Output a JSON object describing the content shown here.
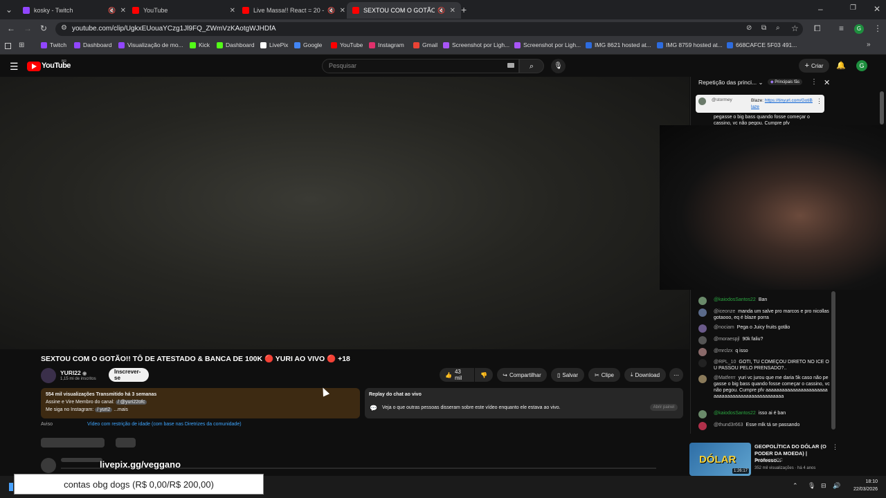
{
  "tabs": [
    {
      "title": "kosky - Twitch",
      "color": "#9146ff",
      "muted": true
    },
    {
      "title": "YouTube",
      "color": "#ff0000",
      "muted": false
    },
    {
      "title": "Live Massa!! React = 20 - Yo",
      "color": "#ff0000",
      "muted": true
    },
    {
      "title": "SEXTOU COM O GOTÃO!! TÔ",
      "color": "#ff0000",
      "muted": true
    }
  ],
  "address": {
    "url": "youtube.com/clip/UgkxEUouaYCzg1Jl9FQ_ZWmVzKAotgWJHDfA"
  },
  "bookmarks": [
    {
      "label": "Twitch",
      "color": "#9146ff"
    },
    {
      "label": "Dashboard",
      "color": "#9146ff"
    },
    {
      "label": "Visualização de mo...",
      "color": "#9146ff"
    },
    {
      "label": "Kick",
      "color": "#53fc18"
    },
    {
      "label": "Dashboard",
      "color": "#53fc18"
    },
    {
      "label": "LivePix",
      "color": "#ffffff"
    },
    {
      "label": "Google",
      "color": "#4285f4"
    },
    {
      "label": "YouTube",
      "color": "#ff0000"
    },
    {
      "label": "Instagram",
      "color": "#e1306c"
    },
    {
      "label": "Gmail",
      "color": "#ea4335"
    },
    {
      "label": "Screenshot por Ligh...",
      "color": "#a855f7"
    },
    {
      "label": "Screenshot por Ligh...",
      "color": "#a855f7"
    },
    {
      "label": "IMG 8621 hosted at...",
      "color": "#2d6cdf"
    },
    {
      "label": "IMG 8759 hosted at...",
      "color": "#2d6cdf"
    },
    {
      "label": "668CAFCE 5F03 491...",
      "color": "#2d6cdf"
    }
  ],
  "yt": {
    "logo": "YouTube",
    "region": "BR",
    "search_placeholder": "Pesquisar",
    "create_label": "Criar",
    "avatar_letter": "G"
  },
  "video": {
    "title": "SEXTOU COM O GOTÃO!! TÔ DE ATESTADO & BANCA DE 100K 🔴 YURI AO VIVO 🔴 +18",
    "channel": "YURI22",
    "subscribers": "1,15 mi de inscritos",
    "subscribe_label": "Inscrever-se",
    "likes": "43 mil",
    "share_label": "Compartilhar",
    "save_label": "Salvar",
    "clip_label": "Clipe",
    "download_label": "Download"
  },
  "description": {
    "stats": "554 mil visualizações  Transmitido há 3 semanas",
    "line1": "Assine e Vire Membro do canal: ",
    "line1_link": "/ @yuri22ofc",
    "line2": "Me siga no Instagram: ",
    "line2_link": "/ yuri2",
    "more": "...mais"
  },
  "notice": {
    "label": "Aviso",
    "text": "Vídeo com restrição de idade (com base nas Diretrizes da comunidade)"
  },
  "chat_replay": {
    "title": "Replay do chat ao vivo",
    "text": "Veja o que outras pessoas disseram sobre este vídeo enquanto ele estava ao vivo.",
    "button": "Abrir painel"
  },
  "chat": {
    "header": "Repetição das princi...",
    "badge": "Principais fãs",
    "pinned_author": "@stormey",
    "pinned_text": "Blaze: ",
    "pinned_link": "https://tinyurl.com/GotiBlaze",
    "top_text": "pegasse o big bass quando fosse começar o cassino, vc não pegou. Cumpre pfv",
    "messages": [
      {
        "author": "@kaiodosSantos22",
        "text": "Ban",
        "color": "#2ba640"
      },
      {
        "author": "@iceonze",
        "text": "manda um salve pro marcos e pro nicollas gotaooo, eq é blaze porra",
        "color": "#aaaaaa"
      },
      {
        "author": "@nociam",
        "text": "Pega o Juicy fruits gotão",
        "color": "#aaaaaa"
      },
      {
        "author": "@moraespjl",
        "text": "90k faliu?",
        "color": "#aaaaaa"
      },
      {
        "author": "@mrclzx",
        "text": "q isso",
        "color": "#aaaaaa"
      },
      {
        "author": "@RPL_10",
        "text": "GOTI, TU COMEÇOU DIRETO NO ICE OU PASSOU PELO PRENSADO?..",
        "color": "#aaaaaa"
      },
      {
        "author": "@Matferrr",
        "text": "yuri vc jurou que me daria 5k caso não pegasse o big bass quando fosse começar o cassino, vc não pegou. Cumpre pfv aaaaaaaaaaaaaaaaaaaaaaaaaaaaaaaaaaaaaaaaaaaaaaaaa",
        "color": "#aaaaaa"
      },
      {
        "author": "@kaiodosSantos22",
        "text": "isso ai é ban",
        "color": "#2ba640"
      },
      {
        "author": "@thund3r663",
        "text": "Esse mlk tá se passando",
        "color": "#aaaaaa"
      }
    ]
  },
  "recommendation": {
    "title": "GEOPOLÍTICA DO DÓLAR (O PODER DA MOEDA) | Professo...",
    "channel": "Professor HOC",
    "meta": "352 mil visualizações · há 4 anos",
    "duration": "1:26:17",
    "thumb_text": "DÓLAR"
  },
  "overlay": {
    "livepix": "livepix.gg/veggano",
    "goal": "contas obg dogs (R$ 0,00/R$ 200,00)"
  },
  "taskbar": {
    "time": "18:10",
    "date": "22/03/2026"
  }
}
